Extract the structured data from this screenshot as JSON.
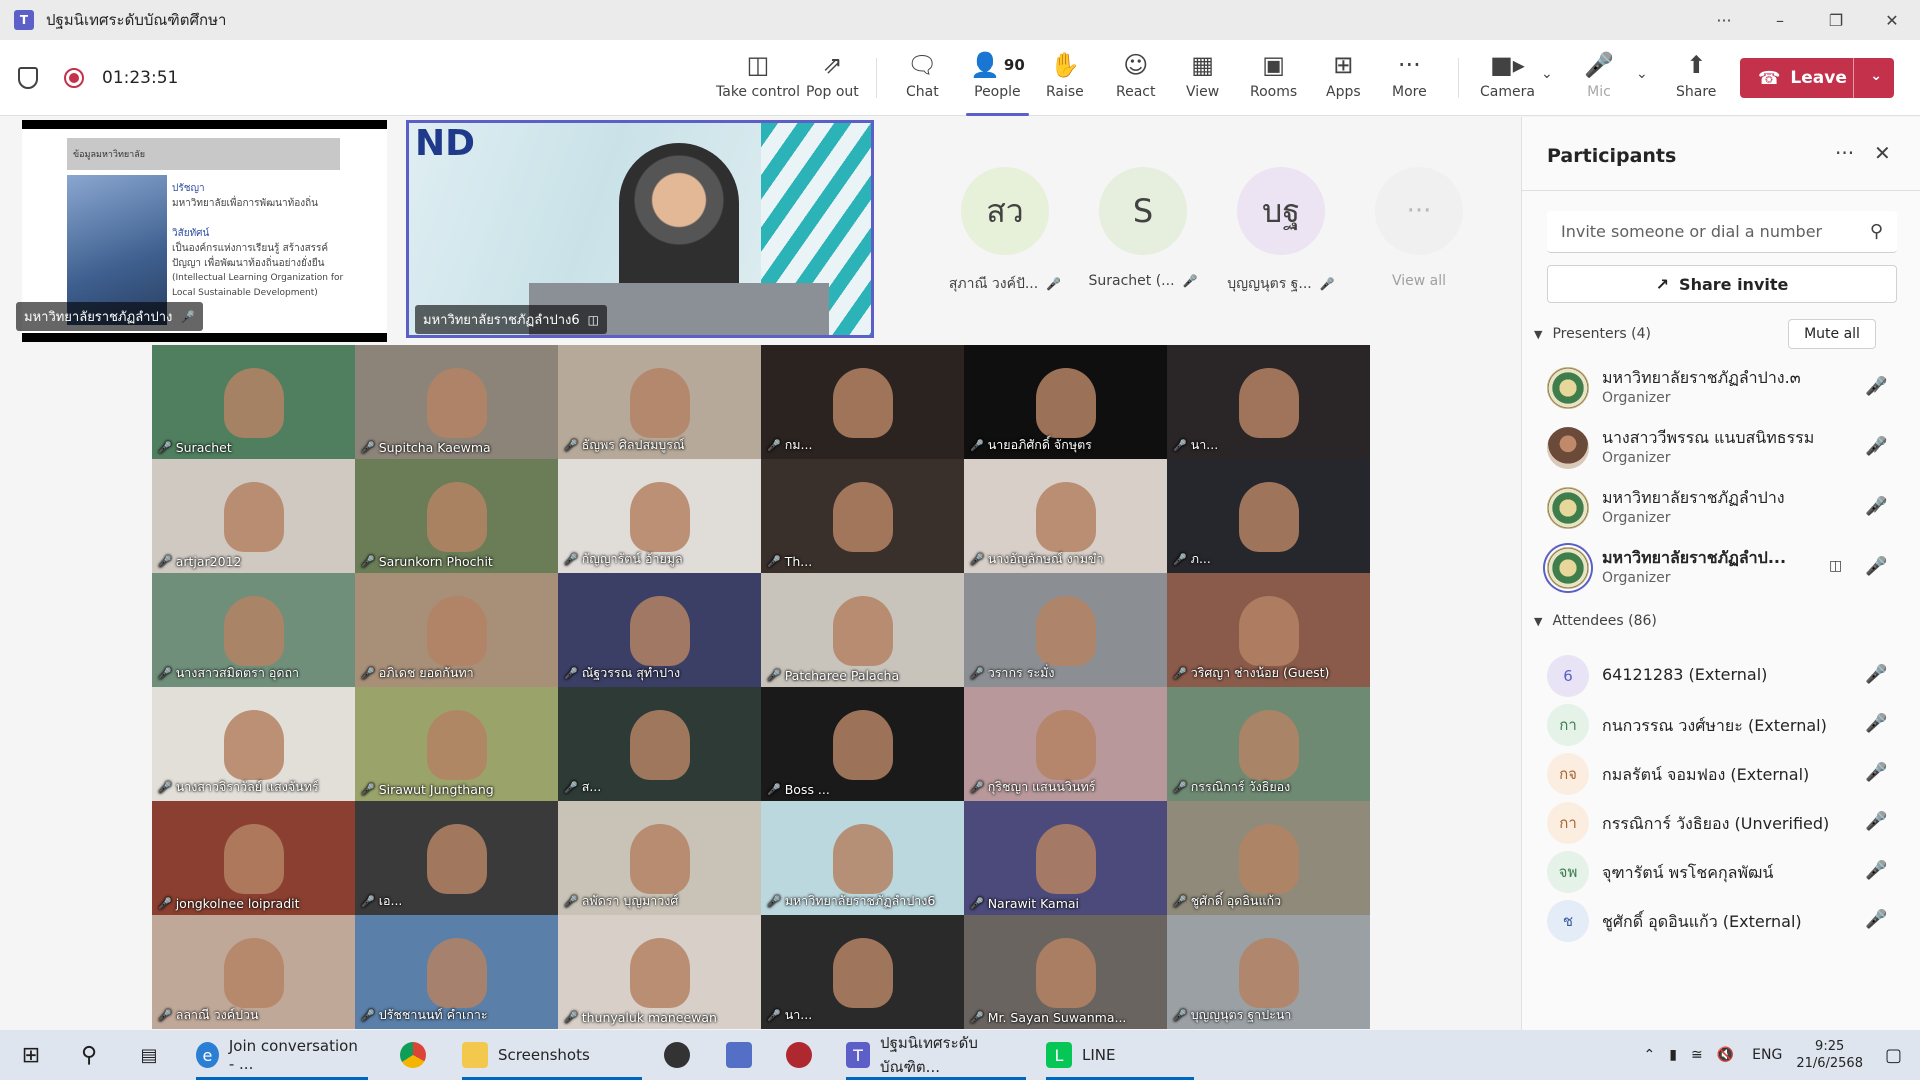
{
  "window": {
    "title": "ปฐมนิเทศระดับบัณฑิตศึกษา",
    "app_icon": "T"
  },
  "meeting": {
    "timer": "01:23:51"
  },
  "toolbar": {
    "take_control": "Take control",
    "pop_out": "Pop out",
    "chat": "Chat",
    "people": "People",
    "people_count": "90",
    "raise": "Raise",
    "react": "React",
    "view": "View",
    "rooms": "Rooms",
    "apps": "Apps",
    "more": "More",
    "camera": "Camera",
    "mic": "Mic",
    "share": "Share",
    "leave": "Leave"
  },
  "stage": {
    "share_label": "มหาวิทยาลัยราชภัฏลำปาง",
    "slide": {
      "header": "ข้อมูลมหาวิทยาลัย",
      "lines": [
        "ปรัชญา",
        "มหาวิทยาลัยเพื่อการพัฒนาท้องถิ่น",
        "",
        "วิสัยทัศน์",
        "เป็นองค์กรแห่งการเรียนรู้ สร้างสรรค์",
        "ปัญญา เพื่อพัฒนาท้องถิ่นอย่างยั่งยืน",
        "(Intellectual Learning Organization for",
        "Local Sustainable Development)"
      ]
    },
    "speaker_label": "มหาวิทยาลัยราชภัฏลำปาง6",
    "speaker_banner": "ND"
  },
  "avatars": [
    {
      "initials": "สว",
      "name": "สุภาณี วงค์ปั...",
      "color": "#e7f0d8"
    },
    {
      "initials": "S",
      "name": "Surachet (...",
      "color": "#e6eedd"
    },
    {
      "initials": "บฐ",
      "name": "บุญญนุตร ฐ...",
      "color": "#ece4f2"
    },
    {
      "initials": "···",
      "name": "View all",
      "color": "#f0f0f0"
    }
  ],
  "grid": [
    {
      "name": "Surachet",
      "bg": "#4f7f5e"
    },
    {
      "name": "Supitcha Kaewma",
      "bg": "#8c8479"
    },
    {
      "name": "ธัญพร ศิลปสมบูรณ์",
      "bg": "#b6a999"
    },
    {
      "name": "กม...",
      "bg": "#2a2320"
    },
    {
      "name": "นายอภิศักดิ์ จักษุตร",
      "bg": "#0f0f0f"
    },
    {
      "name": "นา...",
      "bg": "#2a2526"
    },
    {
      "name": "artjar2012",
      "bg": "#cfc9c2"
    },
    {
      "name": "Sarunkorn Phochit",
      "bg": "#6a7d56"
    },
    {
      "name": "กัญญารัตน์ อ้ายมูล",
      "bg": "#e0dcd8"
    },
    {
      "name": "Th...",
      "bg": "#3a302b"
    },
    {
      "name": "นางอัญลักษณ์ งามขำ",
      "bg": "#d7cfc8"
    },
    {
      "name": "ภ...",
      "bg": "#26272c"
    },
    {
      "name": "นางสาวสมิดตรา อุดถา",
      "bg": "#6f8f7a"
    },
    {
      "name": "อภิเดช ยอดกันทา",
      "bg": "#a78f78"
    },
    {
      "name": "ณัฐวรรณ สุทำปาง",
      "bg": "#3b3f66"
    },
    {
      "name": "Patcharee Palacha",
      "bg": "#c8c3bb"
    },
    {
      "name": "วรากร ระมั่ง",
      "bg": "#8b8f93"
    },
    {
      "name": "วริศญา ช่างน้อย (Guest)",
      "bg": "#8a5a4a"
    },
    {
      "name": "นางสาวจิราวัลย์ แสงจันทร์",
      "bg": "#e2ded8"
    },
    {
      "name": "Sirawut Jungthang",
      "bg": "#9aa46a"
    },
    {
      "name": "ส...",
      "bg": "#2d3a36"
    },
    {
      "name": "Boss ...",
      "bg": "#1a1a1a"
    },
    {
      "name": "กุริชญา แสนนวินทร์",
      "bg": "#b8989a"
    },
    {
      "name": "กรรณิการ์ วังธิยอง",
      "bg": "#6f8a72"
    },
    {
      "name": "jongkolnee loipradit",
      "bg": "#8a3f30"
    },
    {
      "name": "เอ...",
      "bg": "#3a3a3a"
    },
    {
      "name": "ลพัดรา บุญมาวงศ์",
      "bg": "#c9c2b6"
    },
    {
      "name": "มหาวิทยาลัยราชภัฏลำปาง6",
      "bg": "#bcd8df"
    },
    {
      "name": "Narawit Kamai",
      "bg": "#4b4a7a"
    },
    {
      "name": "ชูศักดิ์ อุดอินแก้ว",
      "bg": "#8f8a7a"
    },
    {
      "name": "ลลาณี วงค์ปวน",
      "bg": "#bfa898"
    },
    {
      "name": "ปรัชชานนท์ คำเกาะ",
      "bg": "#5a7fa8"
    },
    {
      "name": "thunyaluk maneewan",
      "bg": "#d8d0c8"
    },
    {
      "name": "นา...",
      "bg": "#2b2a2a"
    },
    {
      "name": "Mr. Sayan Suwanma...",
      "bg": "#6a6460"
    },
    {
      "name": "บุญญนุตร ฐาปะนา",
      "bg": "#9aa0a4"
    }
  ],
  "panel": {
    "title": "Participants",
    "invite_placeholder": "Invite someone or dial a number",
    "share_invite": "Share invite",
    "presenters_label": "Presenters (4)",
    "mute_all": "Mute all",
    "attendees_label": "Attendees (86)",
    "presenters": [
      {
        "name": "มหาวิทยาลัยราชภัฏลำปาง.๓",
        "role": "Organizer",
        "avatar": "seal"
      },
      {
        "name": "นางสาววีพรรณ แนบสนิทธรรม",
        "role": "Organizer",
        "avatar": "photo"
      },
      {
        "name": "มหาวิทยาลัยราชภัฏลำปาง",
        "role": "Organizer",
        "avatar": "seal"
      },
      {
        "name": "มหาวิทยาลัยราชภัฏลำป...",
        "role": "Organizer",
        "avatar": "seal"
      }
    ],
    "attendees": [
      {
        "initials": "6",
        "name": "64121283 (External)",
        "color": "#e8e4f5",
        "fg": "#5b5fc7"
      },
      {
        "initials": "กา",
        "name": "กนกวรรณ วงศ์ษายะ (External)",
        "color": "#e4f2e8",
        "fg": "#3d7a4f"
      },
      {
        "initials": "กจ",
        "name": "กมลรัตน์ จอมฟอง (External)",
        "color": "#fbeee0",
        "fg": "#a8642a"
      },
      {
        "initials": "กา",
        "name": "กรรณิการ์ วังธิยอง (Unverified)",
        "color": "#fbeee0",
        "fg": "#a8642a"
      },
      {
        "initials": "จพ",
        "name": "จุฑารัตน์ พรโชคกุลพัฒน์",
        "color": "#e4f2e8",
        "fg": "#3d7a4f"
      },
      {
        "initials": "ช",
        "name": "ชูศักดิ์ อุดอินแก้ว (External)",
        "color": "#e4ecf7",
        "fg": "#3a5fa0"
      }
    ]
  },
  "taskbar": {
    "teams_chat": "Join conversation - ...",
    "screenshots": "Screenshots",
    "teams_meeting": "ปฐมนิเทศระดับบัณฑิต...",
    "line": "LINE",
    "lang": "ENG",
    "time": "9:25",
    "date": "21/6/2568"
  }
}
